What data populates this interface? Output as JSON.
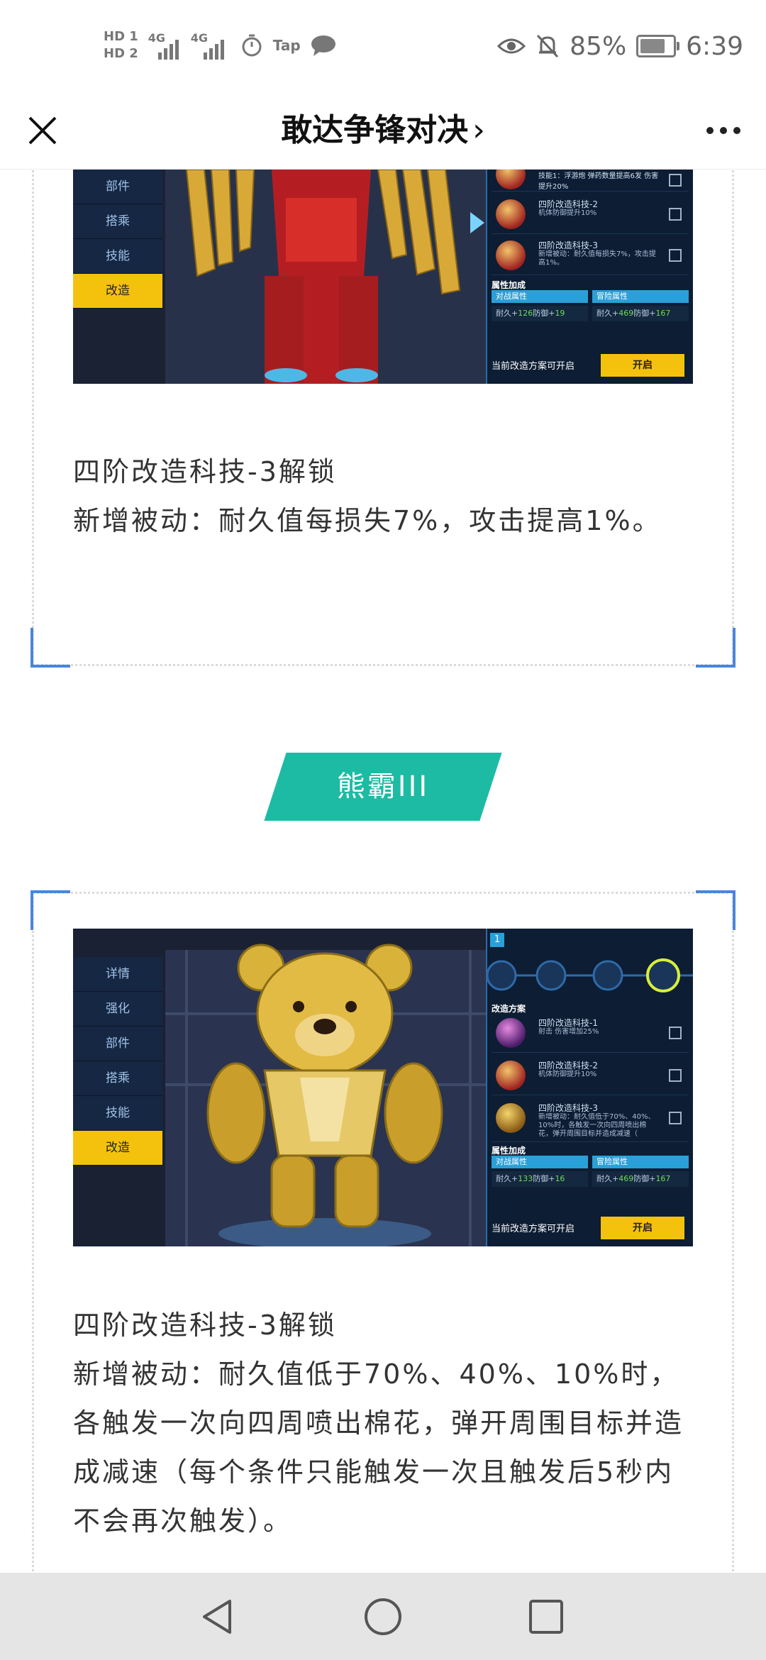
{
  "status_bar": {
    "hd1": "HD 1",
    "hd2": "HD 2",
    "net1": "4G",
    "net2": "4G",
    "app_label": "Tap",
    "battery": "85%",
    "time": "6:39"
  },
  "title_bar": {
    "title": "敢达争锋对决",
    "chevron": "›"
  },
  "card1": {
    "menu": [
      "部件",
      "搭乘",
      "技能",
      "改造"
    ],
    "plans": [
      {
        "title": "技能1：浮游炮 弹药数量提高6发 伤害提升20%",
        "desc": ""
      },
      {
        "title": "四阶改造科技-2",
        "desc": "机体防御提升10%"
      },
      {
        "title": "四阶改造科技-3",
        "desc": "新增被动：耐久值每损失7%，攻击提高1%。"
      }
    ],
    "attr_title": "属性加成",
    "attr_tabs": [
      "对战属性",
      "冒险属性"
    ],
    "attr_left": {
      "pre": "耐久+",
      "v1": "126",
      "mid": "防御+",
      "v2": "19"
    },
    "attr_right": {
      "pre": "耐久+",
      "v1": "469",
      "mid": "防御+",
      "v2": "167"
    },
    "open_label": "当前改造方案可开启",
    "open_button": "开启",
    "text_heading": "四阶改造科技-3解锁",
    "text_body": "新增被动：耐久值每损失7%，攻击提高1%。"
  },
  "section_tag": "熊霸III",
  "card2": {
    "badge": "1",
    "menu": [
      "详情",
      "强化",
      "部件",
      "搭乘",
      "技能",
      "改造"
    ],
    "plan_header": "改造方案",
    "plans": [
      {
        "title": "四阶改造科技-1",
        "desc": "射击 伤害增加25%"
      },
      {
        "title": "四阶改造科技-2",
        "desc": "机体防御提升10%"
      },
      {
        "title": "四阶改造科技-3",
        "desc": "新增被动：耐久值低于70%、40%、10%时，各触发一次向四周喷出棉花，弹开周围目标并造成减速（"
      }
    ],
    "attr_title": "属性加成",
    "attr_tabs": [
      "对战属性",
      "冒险属性"
    ],
    "attr_left": {
      "pre": "耐久+",
      "v1": "133",
      "mid": "防御+",
      "v2": "16"
    },
    "attr_right": {
      "pre": "耐久+",
      "v1": "469",
      "mid": "防御+",
      "v2": "167"
    },
    "open_label": "当前改造方案可开启",
    "open_button": "开启",
    "text_heading": "四阶改造科技-3解锁",
    "text_body": "新增被动：耐久值低于70%、40%、10%时，各触发一次向四周喷出棉花，弹开周围目标并造成减速（每个条件只能触发一次且触发后5秒内不会再次触发）。"
  },
  "colors": {
    "accent_blue": "#4a86d9",
    "tag_teal": "#1dbba4",
    "game_yellow": "#f4c20d"
  }
}
